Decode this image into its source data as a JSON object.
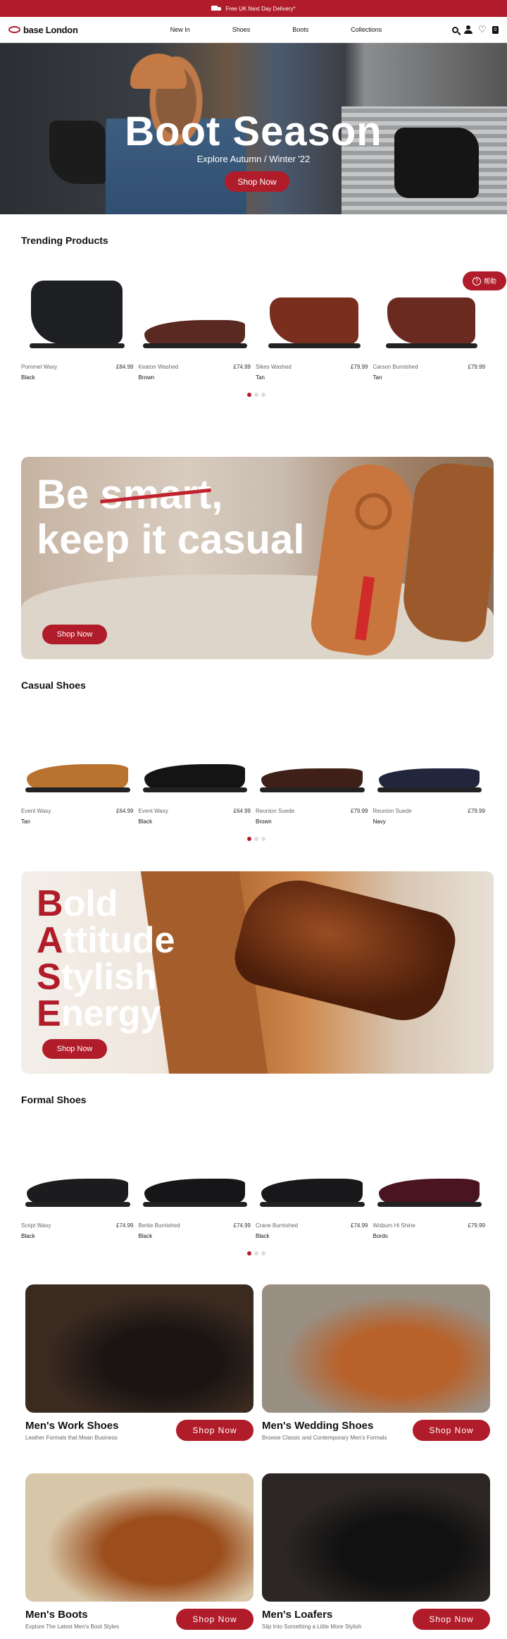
{
  "topbar": {
    "delivery": "Free UK Next Day Delivery*"
  },
  "header": {
    "logo": "base London",
    "nav": [
      "New In",
      "Shoes",
      "Boots",
      "Collections"
    ],
    "bag_count": "0"
  },
  "hero": {
    "title": "Boot Season",
    "subtitle": "Explore Autumn / Winter '22",
    "cta": "Shop Now"
  },
  "help": {
    "label": "帮助"
  },
  "trending": {
    "title": "Trending Products",
    "products": [
      {
        "name": "Pommel Waxy",
        "price": "£84.99",
        "color": "Black",
        "swatch": "#1e1f22",
        "kind": "boot"
      },
      {
        "name": "Keaton Washed",
        "price": "£74.99",
        "color": "Brown",
        "swatch": "#5a2a22",
        "kind": "shoe"
      },
      {
        "name": "Sikes Washed",
        "price": "£79.99",
        "color": "Tan",
        "swatch": "#7a2f1e",
        "kind": "chelsea"
      },
      {
        "name": "Carson Burnished",
        "price": "£79.99",
        "color": "Tan",
        "swatch": "#6b2a1f",
        "kind": "chelsea"
      }
    ]
  },
  "banner_casual": {
    "line1_a": "Be ",
    "line1_strike": "smart",
    "line1_b": ",",
    "line2": "keep it casual",
    "cta": "Shop Now"
  },
  "casual": {
    "title": "Casual Shoes",
    "products": [
      {
        "name": "Event Waxy",
        "price": "£64.99",
        "color": "Tan",
        "swatch": "#b8742f",
        "kind": "shoe"
      },
      {
        "name": "Event Waxy",
        "price": "£64.99",
        "color": "Black",
        "swatch": "#141414",
        "kind": "shoe"
      },
      {
        "name": "Reunion Suede",
        "price": "£79.99",
        "color": "Brown",
        "swatch": "#3e2019",
        "kind": "loafer"
      },
      {
        "name": "Reunion Suede",
        "price": "£79.99",
        "color": "Navy",
        "swatch": "#22263d",
        "kind": "loafer"
      }
    ]
  },
  "banner_base": {
    "lines": [
      {
        "initial": "B",
        "rest": "old"
      },
      {
        "initial": "A",
        "rest": "ttitude"
      },
      {
        "initial": "S",
        "rest": "tylish"
      },
      {
        "initial": "E",
        "rest": "nergy"
      }
    ],
    "cta": "Shop Now"
  },
  "formal": {
    "title": "Formal Shoes",
    "products": [
      {
        "name": "Script Waxy",
        "price": "£74.99",
        "color": "Black",
        "swatch": "#1c1c1e",
        "kind": "shoe"
      },
      {
        "name": "Bertie Burnished",
        "price": "£74.99",
        "color": "Black",
        "swatch": "#161618",
        "kind": "shoe"
      },
      {
        "name": "Crane Burnished",
        "price": "£74.99",
        "color": "Black",
        "swatch": "#18181a",
        "kind": "shoe"
      },
      {
        "name": "Woburn Hi Shine",
        "price": "£79.99",
        "color": "Bordo",
        "swatch": "#4a1420",
        "kind": "shoe"
      }
    ]
  },
  "categories": [
    {
      "name": "Men's Work Shoes",
      "desc": "Leather Formals that Mean Business",
      "cta": "Shop Now",
      "bg": "#3a2a20",
      "accent": "#1a1512"
    },
    {
      "name": "Men's Wedding Shoes",
      "desc": "Browse Classic and Contemporary Men's Formals",
      "cta": "Shop Now",
      "bg": "#9a8f83",
      "accent": "#b8612a"
    },
    {
      "name": "Men's Boots",
      "desc": "Explore The Latest Men's Boot Styles",
      "cta": "Shop Now",
      "bg": "#d7c6a7",
      "accent": "#9c4d1c"
    },
    {
      "name": "Men's Loafers",
      "desc": "Slip Into Something a Little More Stylish",
      "cta": "Shop Now",
      "bg": "#2c2724",
      "accent": "#111"
    }
  ]
}
